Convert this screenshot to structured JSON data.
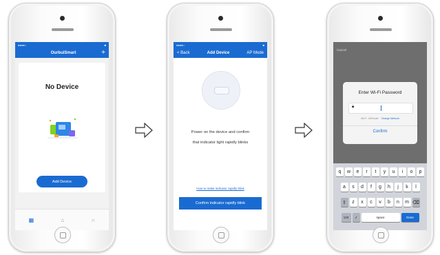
{
  "screen1": {
    "app_title": "OurbuiSmart",
    "empty_title": "No Device",
    "add_button": "Add Device",
    "tabs": [
      "",
      "",
      ""
    ]
  },
  "screen2": {
    "back": "< Back",
    "title": "Add Device",
    "right_action": "AP Mode",
    "instruction_line1": "Power on the device and confirm",
    "instruction_line2": "that indicator light rapidly blinks",
    "help_link": "How to make indicator rapidly blink",
    "confirm_button": "Confirm indicator rapidly blink"
  },
  "screen3": {
    "cancel": "Cancel",
    "dialog_title": "Enter Wi-Fi Password",
    "network_name": "Wi-Fi : A4Router",
    "change_network": "Change Network",
    "confirm": "Confirm",
    "keyboard": {
      "row1": [
        "q",
        "w",
        "e",
        "r",
        "t",
        "y",
        "u",
        "i",
        "o",
        "p"
      ],
      "row2": [
        "a",
        "s",
        "d",
        "f",
        "g",
        "h",
        "j",
        "k",
        "l"
      ],
      "row3": [
        "z",
        "x",
        "c",
        "v",
        "b",
        "n",
        "m"
      ],
      "numbers": "123",
      "space": "space",
      "done": "Done"
    }
  },
  "colors": {
    "accent": "#1a6bd1",
    "overlay": "#6e6e6e",
    "keyboard": "#d1d4da"
  },
  "icons": [
    "plus-icon",
    "device-illustration",
    "home-tab-icon",
    "scene-tab-icon",
    "profile-tab-icon",
    "lock-icon",
    "shift-icon",
    "backspace-icon",
    "mic-icon",
    "right-arrow-icon"
  ]
}
